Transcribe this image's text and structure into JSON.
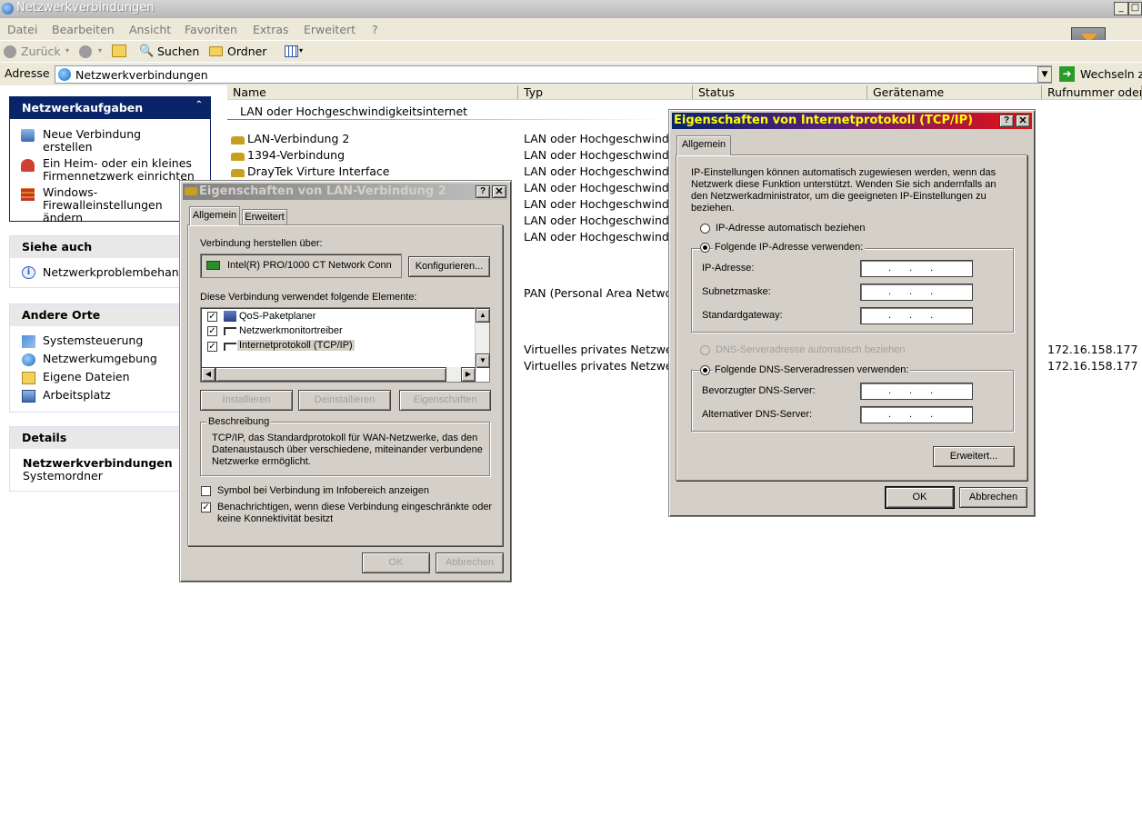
{
  "window": {
    "title": "Netzwerkverbindungen"
  },
  "menu": [
    "Datei",
    "Bearbeiten",
    "Ansicht",
    "Favoriten",
    "Extras",
    "Erweitert",
    "?"
  ],
  "toolbar": {
    "back": "Zurück",
    "search": "Suchen",
    "folders": "Ordner"
  },
  "address": {
    "label": "Adresse",
    "value": "Netzwerkverbindungen",
    "go": "Wechseln zu"
  },
  "left": {
    "tasks": {
      "title": "Netzwerkaufgaben",
      "items": [
        "Neue Verbindung erstellen",
        "Ein Heim- oder ein kleines Firmennetzwerk einrichten",
        "Windows-Firewalleinstellungen ändern"
      ]
    },
    "see_also": {
      "title": "Siehe auch",
      "items": [
        "Netzwerkproblembehandlung"
      ]
    },
    "other": {
      "title": "Andere Orte",
      "items": [
        "Systemsteuerung",
        "Netzwerkumgebung",
        "Eigene Dateien",
        "Arbeitsplatz"
      ]
    },
    "details": {
      "title": "Details",
      "name": "Netzwerkverbindungen",
      "sub": "Systemordner"
    }
  },
  "list": {
    "columns": [
      "Name",
      "Typ",
      "Status",
      "Gerätename",
      "Rufnummer oder Host"
    ],
    "group": "LAN oder Hochgeschwindigkeitsinternet",
    "rows": [
      {
        "name": "LAN-Verbindung 2",
        "type": "LAN oder Hochgeschwindigkeitsinternet"
      },
      {
        "name": "1394-Verbindung",
        "type": "LAN oder Hochgeschwindigkeitsinternet"
      },
      {
        "name": "DrayTek Virture Interface",
        "type": "LAN oder Hochgeschwindigkeitsinternet"
      },
      {
        "name": "",
        "type": "LAN oder Hochgeschwindigkeitsinternet"
      },
      {
        "name": "",
        "type": "LAN oder Hochgeschwindigkeitsinternet"
      },
      {
        "name": "",
        "type": "LAN oder Hochgeschwindigkeitsinternet"
      },
      {
        "name": "",
        "type": "LAN oder Hochgeschwindigkeitsinternet"
      },
      {
        "name": "",
        "type": "PAN (Personal Area Network)"
      },
      {
        "name": "",
        "type": "Virtuelles privates Netzwerk",
        "host": "172.16.158.177"
      },
      {
        "name": "",
        "type": "Virtuelles privates Netzwerk",
        "host": "172.16.158.177"
      }
    ]
  },
  "lan_dialog": {
    "title": "Eigenschaften von LAN-Verbindung 2",
    "tabs": [
      "Allgemein",
      "Erweitert"
    ],
    "connect_label": "Verbindung herstellen über:",
    "adapter": "Intel(R) PRO/1000 CT Network Conn",
    "configure": "Konfigurieren...",
    "elements_label": "Diese Verbindung verwendet folgende Elemente:",
    "elements": [
      "QoS-Paketplaner",
      "Netzwerkmonitortreiber",
      "Internetprotokoll (TCP/IP)"
    ],
    "install": "Installieren",
    "uninstall": "Deinstallieren",
    "properties": "Eigenschaften",
    "desc_title": "Beschreibung",
    "desc": "TCP/IP, das Standardprotokoll für WAN-Netzwerke, das den Datenaustausch über verschiedene, miteinander verbundene Netzwerke ermöglicht.",
    "chk1": "Symbol bei Verbindung im Infobereich anzeigen",
    "chk2": "Benachrichtigen, wenn diese Verbindung eingeschränkte oder keine Konnektivität besitzt",
    "ok": "OK",
    "cancel": "Abbrechen"
  },
  "tcp_dialog": {
    "title": "Eigenschaften von Internetprotokoll (TCP/IP)",
    "tab": "Allgemein",
    "intro": "IP-Einstellungen können automatisch zugewiesen werden, wenn das Netzwerk diese Funktion unterstützt. Wenden Sie sich andernfalls an den Netzwerkadministrator, um die geeigneten IP-Einstellungen zu beziehen.",
    "auto_ip": "IP-Adresse automatisch beziehen",
    "manual_ip": "Folgende IP-Adresse verwenden:",
    "ip_label": "IP-Adresse:",
    "mask_label": "Subnetzmaske:",
    "gw_label": "Standardgateway:",
    "auto_dns": "DNS-Serveradresse automatisch beziehen",
    "manual_dns": "Folgende DNS-Serveradressen verwenden:",
    "dns1_label": "Bevorzugter DNS-Server:",
    "dns2_label": "Alternativer DNS-Server:",
    "advanced": "Erweitert...",
    "ok": "OK",
    "cancel": "Abbrechen"
  },
  "colors": {
    "xp_blue": "#0a246a",
    "title_red": "#e81010",
    "panel_blue": "#215dc6"
  }
}
